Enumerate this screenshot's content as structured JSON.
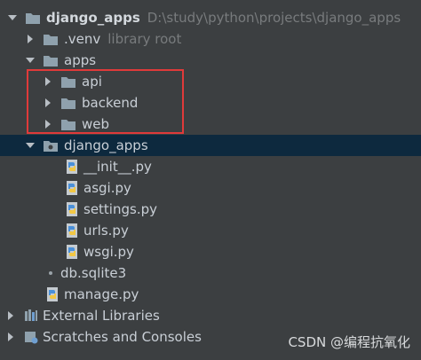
{
  "tree": {
    "root": {
      "name": "django_apps",
      "path": "D:\\study\\python\\projects\\django_apps"
    },
    "venv": {
      "name": ".venv",
      "hint": "library root"
    },
    "apps": {
      "name": "apps",
      "children": [
        "api",
        "backend",
        "web"
      ]
    },
    "package": {
      "name": "django_apps",
      "files": [
        "__init__.py",
        "asgi.py",
        "settings.py",
        "urls.py",
        "wsgi.py"
      ]
    },
    "db": {
      "name": "db.sqlite3"
    },
    "manage": {
      "name": "manage.py"
    },
    "external_libraries": "External Libraries",
    "scratches": "Scratches and Consoles"
  },
  "watermark": "CSDN @编程抗氧化",
  "colors": {
    "background": "#3c3f41",
    "selection": "#0d293e",
    "highlight": "#e03a3a"
  }
}
